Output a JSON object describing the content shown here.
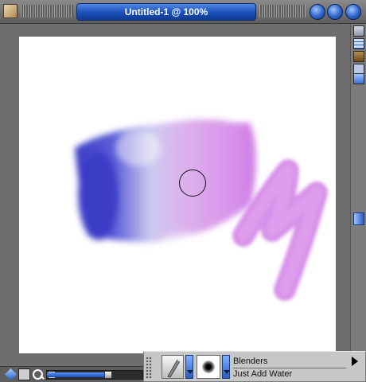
{
  "window": {
    "title": "Untitled-1 @ 100%",
    "icons": {
      "app": "app-icon",
      "minimize": "minimize-icon",
      "maximize": "maximize-icon",
      "close": "close-icon"
    }
  },
  "canvas": {
    "background": "#ffffff",
    "stroke_colors": [
      "#3b3ac4",
      "#b8b8ee",
      "#dcb0ec",
      "#d07ee6"
    ]
  },
  "right_toolbar": {
    "icons": [
      "page-icon",
      "grid-icon",
      "layers-icon",
      "star-icon",
      "scroll-up-icon",
      "scroll-thumb"
    ]
  },
  "bottom_bar": {
    "icons": [
      "layer-adjuster-icon",
      "grabber-icon",
      "zoom-icon"
    ],
    "zoom_slider_value": 0.62
  },
  "brush_selector": {
    "category": "Blenders",
    "variant": "Just Add Water",
    "icons": [
      "brush-category-icon",
      "brush-variant-icon",
      "expand-arrow-icon"
    ]
  }
}
